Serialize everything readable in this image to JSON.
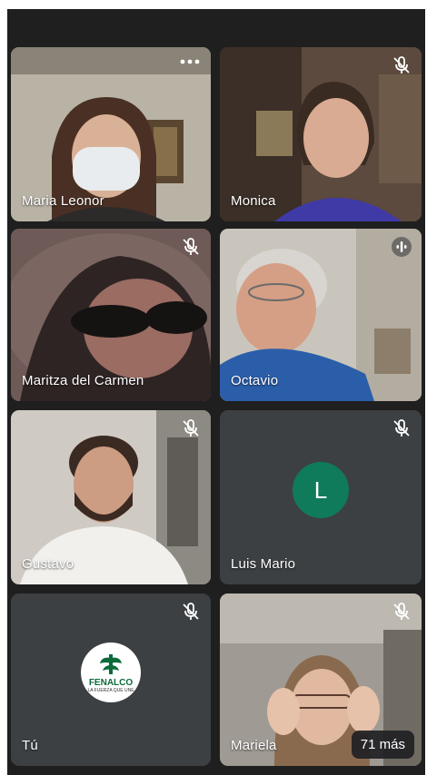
{
  "participants": [
    {
      "name": "Maria Leonor",
      "status": "more-options"
    },
    {
      "name": "Monica",
      "status": "muted"
    },
    {
      "name": "Maritza del Carmen",
      "status": "muted"
    },
    {
      "name": "Octavio",
      "status": "speaking"
    },
    {
      "name": "Gustavo",
      "status": "muted"
    },
    {
      "name": "Luis Mario",
      "status": "muted",
      "initial": "L"
    },
    {
      "name": "Tú",
      "status": "muted",
      "logo": "FENALCO",
      "logo_sub": "LA FUERZA QUE UNE"
    },
    {
      "name": "Mariela",
      "status": "muted"
    }
  ],
  "more_count_label": "71 más",
  "colors": {
    "background": "#1f1f1f",
    "tile": "#3c4043",
    "avatar": "#0f7b5a"
  }
}
